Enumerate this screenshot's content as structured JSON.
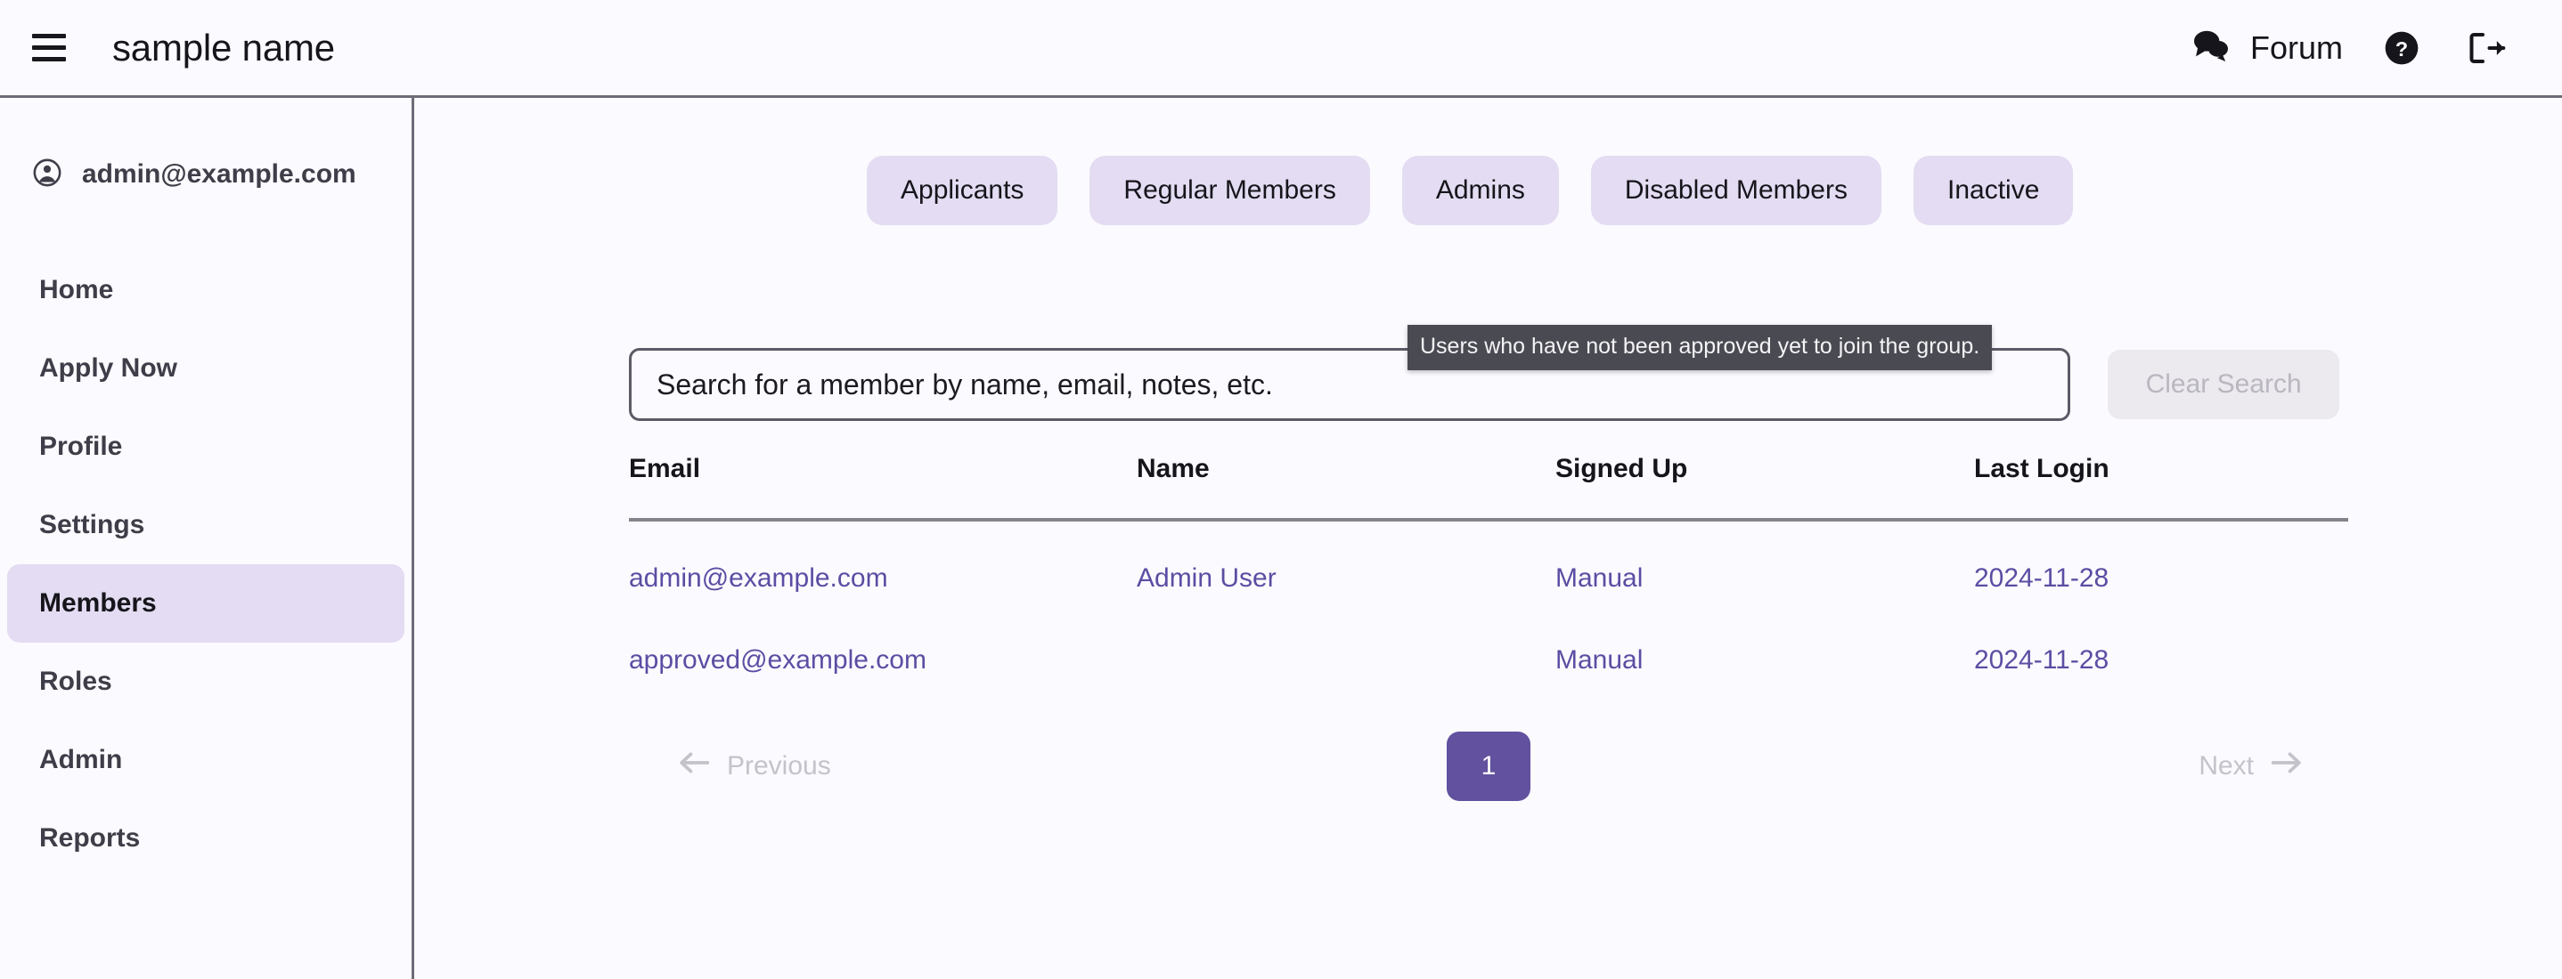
{
  "header": {
    "menu_icon": "hamburger-icon",
    "title": "sample name",
    "forum_label": "Forum",
    "forum_icon": "chat-bubbles-icon",
    "help_icon": "help-circle-icon",
    "logout_icon": "logout-icon"
  },
  "sidebar": {
    "account_icon": "account-circle-icon",
    "account_email": "admin@example.com",
    "items": [
      {
        "label": "Home",
        "active": false
      },
      {
        "label": "Apply Now",
        "active": false
      },
      {
        "label": "Profile",
        "active": false
      },
      {
        "label": "Settings",
        "active": false
      },
      {
        "label": "Members",
        "active": true
      },
      {
        "label": "Roles",
        "active": false
      },
      {
        "label": "Admin",
        "active": false
      },
      {
        "label": "Reports",
        "active": false
      }
    ]
  },
  "main": {
    "tabs": [
      {
        "label": "Applicants"
      },
      {
        "label": "Regular Members"
      },
      {
        "label": "Admins"
      },
      {
        "label": "Disabled Members"
      },
      {
        "label": "Inactive"
      }
    ],
    "tooltip": "Users who have not been approved yet to join the group.",
    "search": {
      "placeholder": "Search for a member by name, email, notes, etc.",
      "value": ""
    },
    "clear_search_label": "Clear Search",
    "table": {
      "columns": [
        "Email",
        "Name",
        "Signed Up",
        "Last Login"
      ],
      "rows": [
        {
          "email": "admin@example.com",
          "name": "Admin User",
          "signed_up": "Manual",
          "last_login": "2024-11-28"
        },
        {
          "email": "approved@example.com",
          "name": "",
          "signed_up": "Manual",
          "last_login": "2024-11-28"
        }
      ]
    },
    "pagination": {
      "previous_label": "Previous",
      "previous_icon": "arrow-left-icon",
      "current_page": "1",
      "next_label": "Next",
      "next_icon": "arrow-right-icon"
    }
  },
  "colors": {
    "accent_purple": "#61519e",
    "tab_background": "#e3dcf2",
    "link_purple": "#5a4ea3",
    "tooltip_background": "#4a4a52",
    "page_background": "#fbfaff",
    "border_gray": "#6f6c77",
    "disabled_gray": "#c4c2ca"
  }
}
